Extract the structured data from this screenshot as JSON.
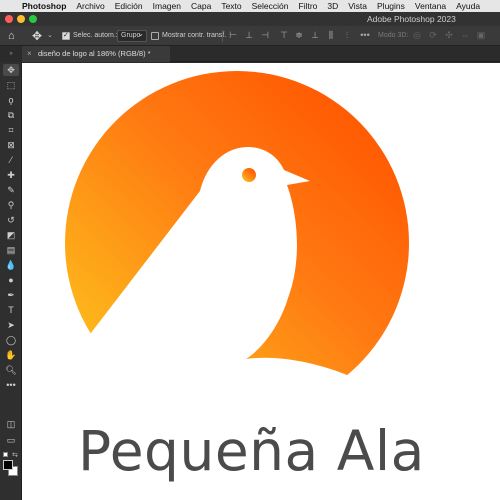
{
  "menubar": {
    "app": "Photoshop",
    "items": [
      "Archivo",
      "Edición",
      "Imagen",
      "Capa",
      "Texto",
      "Selección",
      "Filtro",
      "3D",
      "Vista",
      "Plugins",
      "Ventana",
      "Ayuda"
    ]
  },
  "window": {
    "title": "Adobe Photoshop 2023",
    "traffic_colors": [
      "#ff5f57",
      "#febc2e",
      "#28c840"
    ]
  },
  "options_bar": {
    "auto_select_label": "Selec. autom.:",
    "auto_select_checked": true,
    "auto_select_mode": "Grupo",
    "transform_label": "Mostrar contr. transf.",
    "transform_checked": false,
    "mode3d_label": "Modo 3D:"
  },
  "document_tab": {
    "title": "diseño de logo al 186% (RGB/8) *"
  },
  "toolbar": {
    "tools": [
      "move-tool",
      "marquee-tool",
      "lasso-tool",
      "object-select-tool",
      "crop-tool",
      "frame-tool",
      "eyedropper-tool",
      "healing-tool",
      "brush-tool",
      "stamp-tool",
      "history-brush-tool",
      "eraser-tool",
      "gradient-tool",
      "blur-tool",
      "dodge-tool",
      "pen-tool",
      "type-tool",
      "path-select-tool",
      "shape-tool",
      "hand-tool",
      "zoom-tool",
      "more-tools"
    ],
    "foreground_color": "#000000",
    "background_color": "#ffffff"
  },
  "canvas": {
    "brand_name": "Pequeña Ala",
    "logo_gradient": [
      "#fdbd1c",
      "#ff7a12",
      "#ff5500"
    ],
    "text_color": "#4b4b4b"
  }
}
